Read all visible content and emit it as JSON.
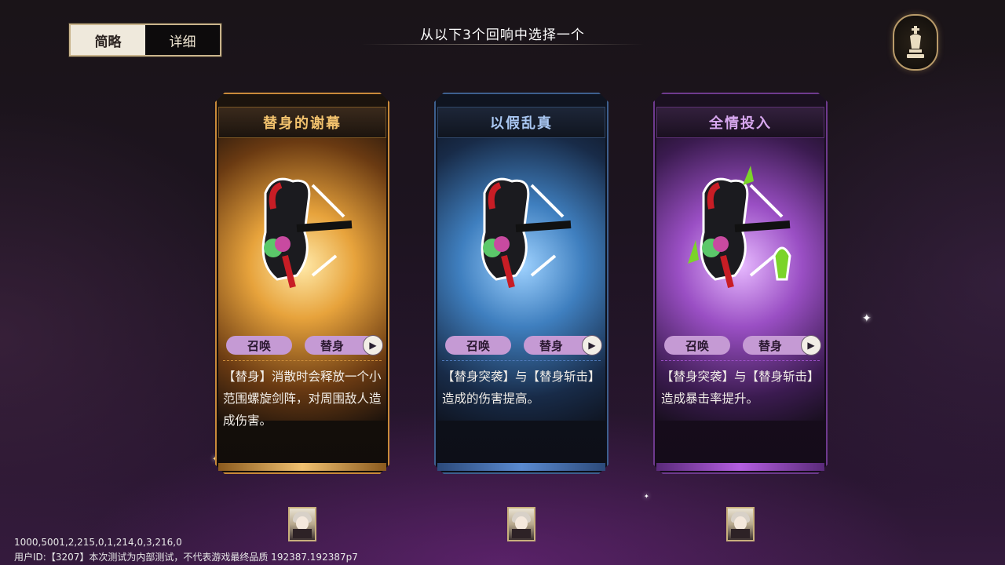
{
  "mode_toggle": {
    "brief": "简略",
    "detail": "详细"
  },
  "title": "从以下3个回响中选择一个",
  "chess_icon": "chess-king-icon",
  "cards": [
    {
      "name": "替身的谢幕",
      "tag1": "召唤",
      "tag2": "替身",
      "desc": "【替身】消散时会释放一个小范围螺旋剑阵，对周围敌人造成伤害。",
      "theme": "gold",
      "accent": "#e6b35a",
      "title_color": "#f3c36e"
    },
    {
      "name": "以假乱真",
      "tag1": "召唤",
      "tag2": "替身",
      "desc": "【替身突袭】与【替身斩击】造成的伤害提高。",
      "theme": "blue",
      "accent": "#4f78b8",
      "title_color": "#a9c7f2"
    },
    {
      "name": "全情投入",
      "tag1": "召唤",
      "tag2": "替身",
      "desc": "【替身突袭】与【替身斩击】造成暴击率提升。",
      "theme": "purple",
      "accent": "#9a4fc4",
      "title_color": "#d8a8f0"
    }
  ],
  "debug_line1": "1000,5001,2,215,0,1,214,0,3,216,0",
  "debug_line2": "用户ID:【3207】本次测试为内部测试，不代表游戏最终品质 192387.192387p7"
}
